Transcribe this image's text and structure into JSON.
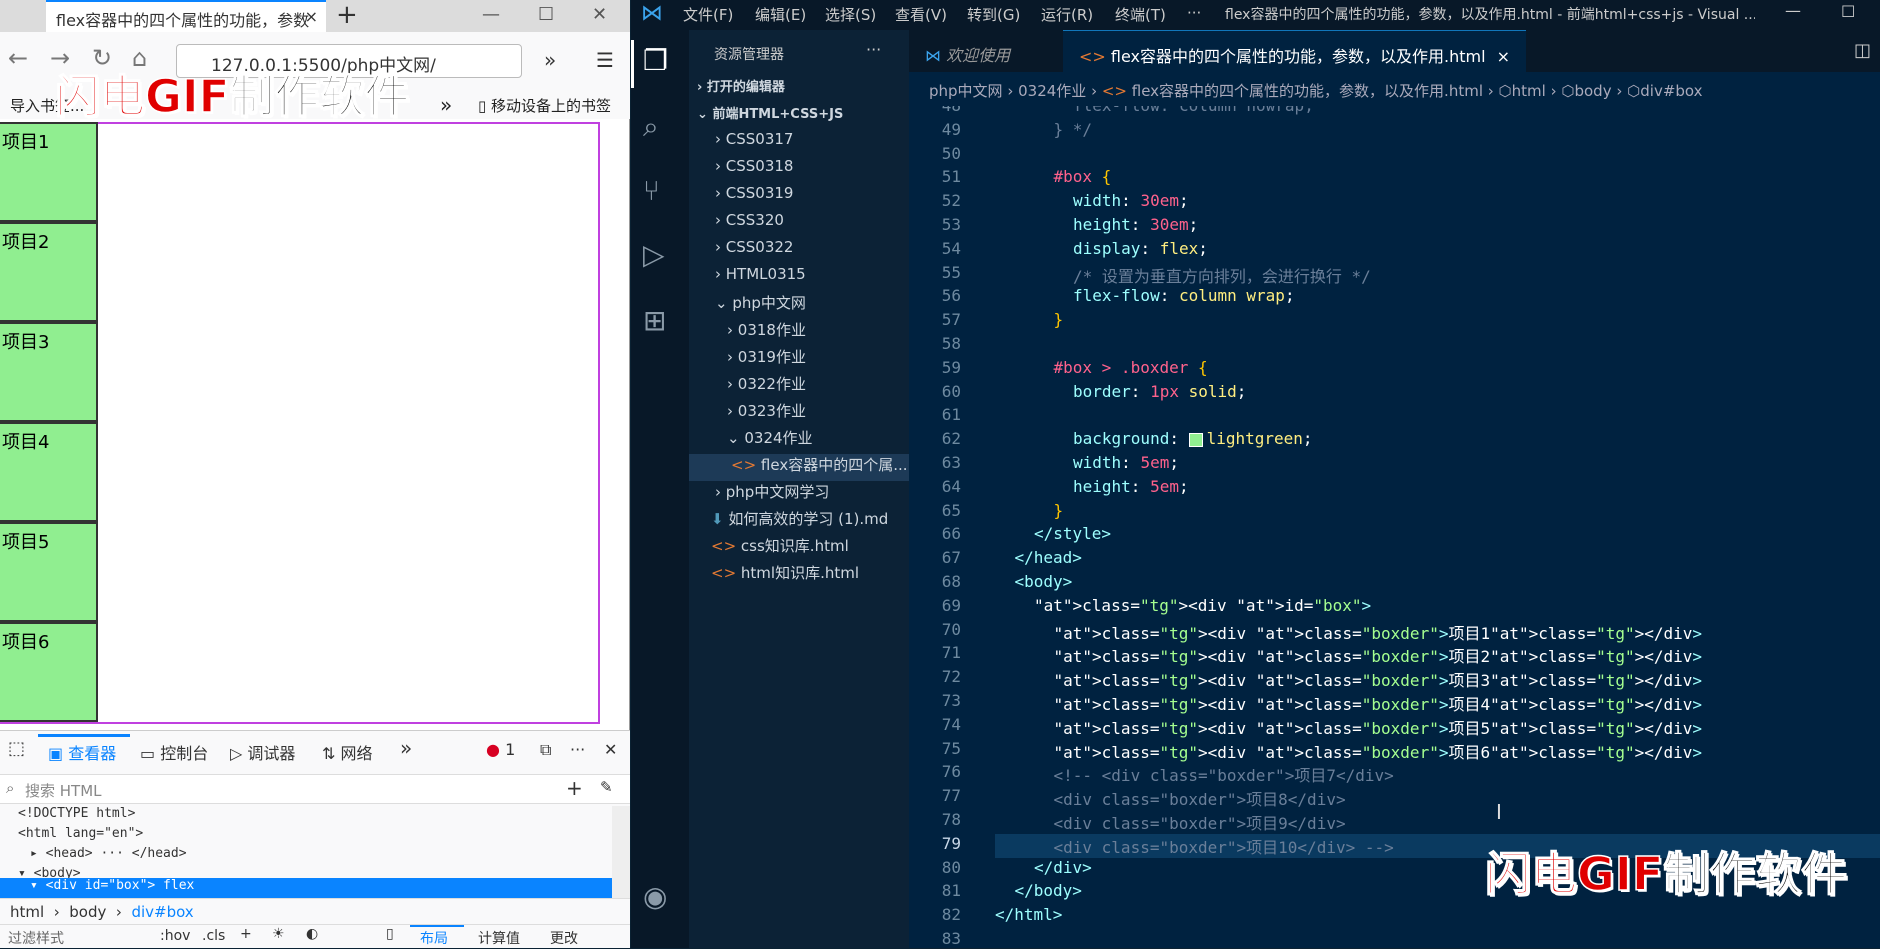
{
  "browser": {
    "tab_title": "flex容器中的四个属性的功能，参数",
    "tab_close": "×",
    "new_tab": "+",
    "url": "127.0.0.1:5500/php中文网/",
    "bookmarks": {
      "item1": "导入书签...",
      "mobile": "移动设备上的书签"
    },
    "page": {
      "items": [
        "项目1",
        "项目2",
        "项目3",
        "项目4",
        "项目5",
        "项目6"
      ]
    }
  },
  "watermark": {
    "red": "闪电GIF",
    "black": "制作软件"
  },
  "devtools": {
    "tabs": [
      "查看器",
      "控制台",
      "调试器",
      "网络"
    ],
    "error_count": "1",
    "search_placeholder": "搜索 HTML",
    "tree": [
      {
        "text": "<!DOCTYPE html>",
        "indent": 0,
        "selected": false
      },
      {
        "text": "<html lang=\"en\">",
        "indent": 0,
        "selected": false
      },
      {
        "text": "▸ <head> ··· </head>",
        "indent": 1,
        "selected": false
      },
      {
        "text": "▾ <body>",
        "indent": 1,
        "selected": false
      },
      {
        "text": "▾ <div id=\"box\"> flex",
        "indent": 2,
        "selected": true
      }
    ],
    "breadcrumbs": [
      "html",
      "body",
      "div#box"
    ],
    "filter_placeholder": "过滤样式",
    "filter_buttons": [
      ":hov",
      ".cls"
    ],
    "bottom_tabs": [
      "布局",
      "计算值",
      "更改"
    ]
  },
  "vscode": {
    "menu": [
      "文件(F)",
      "编辑(E)",
      "选择(S)",
      "查看(V)",
      "转到(G)",
      "运行(R)",
      "终端(T)",
      "···"
    ],
    "window_title": "flex容器中的四个属性的功能，参数，以及作用.html - 前端html+css+js - Visual ...",
    "explorer_title": "资源管理器",
    "explorer_more": "···",
    "tree": [
      {
        "label": "打开的编辑器",
        "level": 0,
        "bold": true,
        "icon": "chevron-right"
      },
      {
        "label": "前端HTML+CSS+JS",
        "level": 0,
        "bold": true,
        "icon": "chevron-down"
      },
      {
        "label": "CSS0317",
        "level": 1,
        "icon": "chevron-right"
      },
      {
        "label": "CSS0318",
        "level": 1,
        "icon": "chevron-right"
      },
      {
        "label": "CSS0319",
        "level": 1,
        "icon": "chevron-right"
      },
      {
        "label": "CSS320",
        "level": 1,
        "icon": "chevron-right"
      },
      {
        "label": "CSS0322",
        "level": 1,
        "icon": "chevron-right"
      },
      {
        "label": "HTML0315",
        "level": 1,
        "icon": "chevron-right"
      },
      {
        "label": "php中文网",
        "level": 1,
        "icon": "chevron-down"
      },
      {
        "label": "0318作业",
        "level": 2,
        "icon": "chevron-right"
      },
      {
        "label": "0319作业",
        "level": 2,
        "icon": "chevron-right"
      },
      {
        "label": "0322作业",
        "level": 2,
        "icon": "chevron-right"
      },
      {
        "label": "0323作业",
        "level": 2,
        "icon": "chevron-right"
      },
      {
        "label": "0324作业",
        "level": 2,
        "icon": "chevron-down"
      },
      {
        "label": "flex容器中的四个属...",
        "level": 3,
        "icon": "html-file",
        "selected": true
      },
      {
        "label": "php中文网学习",
        "level": 1,
        "icon": "chevron-right"
      },
      {
        "label": "如何高效的学习 (1).md",
        "level": 1,
        "icon": "markdown-file"
      },
      {
        "label": "css知识库.html",
        "level": 1,
        "icon": "html-file"
      },
      {
        "label": "html知识库.html",
        "level": 1,
        "icon": "html-file"
      }
    ],
    "editor_tabs": [
      {
        "label": "欢迎使用",
        "active": false
      },
      {
        "label": "flex容器中的四个属性的功能，参数，以及作用.html",
        "active": true,
        "close": "×"
      }
    ],
    "breadcrumbs": [
      "php中文网",
      "0324作业",
      "flex容器中的四个属性的功能，参数，以及作用.html",
      "html",
      "body",
      "div#box"
    ],
    "code_lines": [
      {
        "n": 48,
        "indent": 4,
        "cls": "cm",
        "text": "flex-flow: column nowrap;"
      },
      {
        "n": 49,
        "indent": 3,
        "cls": "cm",
        "text": "} */"
      },
      {
        "n": 50,
        "indent": 0,
        "cls": "",
        "text": ""
      },
      {
        "n": 51,
        "indent": 3,
        "cls": "sel",
        "text": "#box {"
      },
      {
        "n": 52,
        "indent": 4,
        "cls": "decl",
        "text": "width: 30em;"
      },
      {
        "n": 53,
        "indent": 4,
        "cls": "decl",
        "text": "height: 30em;"
      },
      {
        "n": 54,
        "indent": 4,
        "cls": "decl",
        "text": "display: flex;"
      },
      {
        "n": 55,
        "indent": 4,
        "cls": "cm",
        "text": "/* 设置为垂直方向排列，会进行换行 */"
      },
      {
        "n": 56,
        "indent": 4,
        "cls": "decl",
        "text": "flex-flow: column wrap;"
      },
      {
        "n": 57,
        "indent": 3,
        "cls": "br",
        "text": "}"
      },
      {
        "n": 58,
        "indent": 0,
        "cls": "",
        "text": ""
      },
      {
        "n": 59,
        "indent": 3,
        "cls": "sel",
        "text": "#box > .boxder {"
      },
      {
        "n": 60,
        "indent": 4,
        "cls": "decl",
        "text": "border: 1px solid;"
      },
      {
        "n": 61,
        "indent": 0,
        "cls": "",
        "text": ""
      },
      {
        "n": 62,
        "indent": 4,
        "cls": "swatch",
        "text": "background: lightgreen;"
      },
      {
        "n": 63,
        "indent": 4,
        "cls": "decl",
        "text": "width: 5em;"
      },
      {
        "n": 64,
        "indent": 4,
        "cls": "decl",
        "text": "height: 5em;"
      },
      {
        "n": 65,
        "indent": 3,
        "cls": "br",
        "text": "}"
      },
      {
        "n": 66,
        "indent": 2,
        "cls": "tg",
        "text": "</style>"
      },
      {
        "n": 67,
        "indent": 1,
        "cls": "tg",
        "text": "</head>"
      },
      {
        "n": 68,
        "indent": 1,
        "cls": "tg",
        "text": "<body>"
      },
      {
        "n": 69,
        "indent": 2,
        "cls": "tag",
        "text": "<div id=\"box\">"
      },
      {
        "n": 70,
        "indent": 3,
        "cls": "tag",
        "text": "<div class=\"boxder\">项目1</div>"
      },
      {
        "n": 71,
        "indent": 3,
        "cls": "tag",
        "text": "<div class=\"boxder\">项目2</div>"
      },
      {
        "n": 72,
        "indent": 3,
        "cls": "tag",
        "text": "<div class=\"boxder\">项目3</div>"
      },
      {
        "n": 73,
        "indent": 3,
        "cls": "tag",
        "text": "<div class=\"boxder\">项目4</div>"
      },
      {
        "n": 74,
        "indent": 3,
        "cls": "tag",
        "text": "<div class=\"boxder\">项目5</div>"
      },
      {
        "n": 75,
        "indent": 3,
        "cls": "tag",
        "text": "<div class=\"boxder\">项目6</div>"
      },
      {
        "n": 76,
        "indent": 3,
        "cls": "cm",
        "text": "<!-- <div class=\"boxder\">项目7</div>"
      },
      {
        "n": 77,
        "indent": 3,
        "cls": "cm",
        "text": "<div class=\"boxder\">项目8</div>"
      },
      {
        "n": 78,
        "indent": 3,
        "cls": "cm",
        "text": "<div class=\"boxder\">项目9</div>"
      },
      {
        "n": 79,
        "indent": 3,
        "cls": "cm",
        "text": "<div class=\"boxder\">项目10</div> -->",
        "current": true
      },
      {
        "n": 80,
        "indent": 2,
        "cls": "tg",
        "text": "</div>"
      },
      {
        "n": 81,
        "indent": 1,
        "cls": "tg",
        "text": "</body>"
      },
      {
        "n": 82,
        "indent": 0,
        "cls": "tg",
        "text": "</html>"
      },
      {
        "n": 83,
        "indent": 0,
        "cls": "",
        "text": ""
      }
    ]
  }
}
